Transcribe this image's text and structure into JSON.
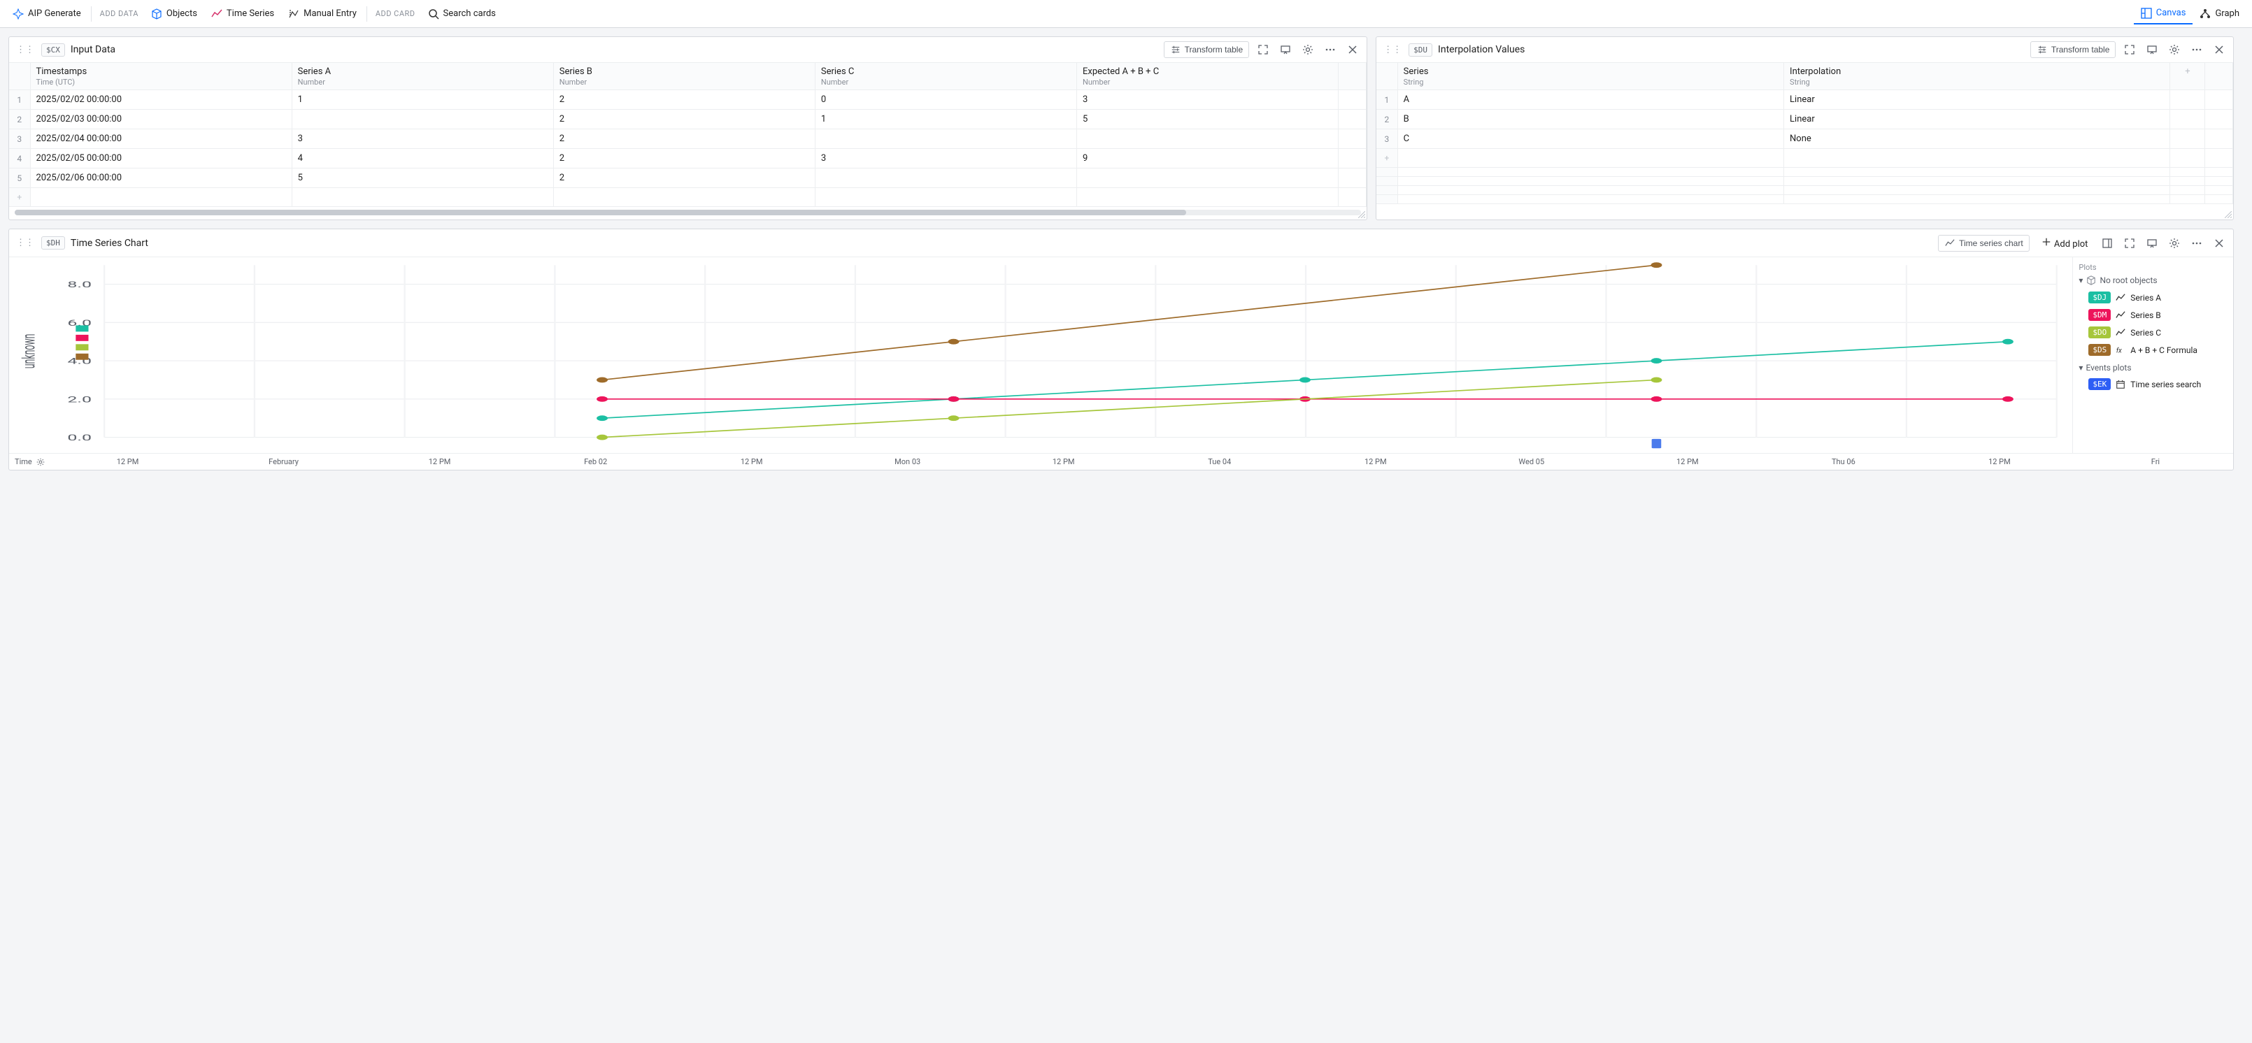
{
  "toolbar": {
    "aip_generate": "AIP Generate",
    "add_data_label": "ADD DATA",
    "objects": "Objects",
    "time_series": "Time Series",
    "manual_entry": "Manual Entry",
    "add_card_label": "ADD CARD",
    "search_placeholder": "Search cards",
    "canvas_tab": "Canvas",
    "graph_tab": "Graph"
  },
  "card_input": {
    "token": "$CX",
    "title": "Input Data",
    "transform_label": "Transform table",
    "columns": [
      {
        "name": "Timestamps",
        "type": "Time (UTC)"
      },
      {
        "name": "Series A",
        "type": "Number"
      },
      {
        "name": "Series B",
        "type": "Number"
      },
      {
        "name": "Series C",
        "type": "Number"
      },
      {
        "name": "Expected A + B + C",
        "type": "Number"
      }
    ],
    "rows": [
      [
        "2025/02/02 00:00:00",
        "1",
        "2",
        "0",
        "3"
      ],
      [
        "2025/02/03 00:00:00",
        "",
        "2",
        "1",
        "5"
      ],
      [
        "2025/02/04 00:00:00",
        "3",
        "2",
        "",
        ""
      ],
      [
        "2025/02/05 00:00:00",
        "4",
        "2",
        "3",
        "9"
      ],
      [
        "2025/02/06 00:00:00",
        "5",
        "2",
        "",
        ""
      ]
    ]
  },
  "card_interp": {
    "token": "$DU",
    "title": "Interpolation Values",
    "transform_label": "Transform table",
    "columns": [
      {
        "name": "Series",
        "type": "String"
      },
      {
        "name": "Interpolation",
        "type": "String"
      }
    ],
    "rows": [
      [
        "A",
        "Linear"
      ],
      [
        "B",
        "Linear"
      ],
      [
        "C",
        "None"
      ]
    ]
  },
  "card_chart": {
    "token": "$DH",
    "title": "Time Series Chart",
    "type_label": "Time series chart",
    "add_plot": "Add plot",
    "legend": {
      "plots_label": "Plots",
      "no_root": "No root objects",
      "items": [
        {
          "token": "$DJ",
          "color": "#1bbfa3",
          "label": "Series A",
          "icon": "line"
        },
        {
          "token": "$DM",
          "color": "#ed145b",
          "label": "Series B",
          "icon": "line"
        },
        {
          "token": "$DO",
          "color": "#a6c63b",
          "label": "Series C",
          "icon": "line"
        },
        {
          "token": "$DS",
          "color": "#9e6b2a",
          "label": "A + B + C Formula",
          "icon": "formula"
        }
      ],
      "events_label": "Events plots",
      "events_item": {
        "token": "$EK",
        "color": "#2d5ef5",
        "label": "Time series search"
      }
    },
    "y_label": "unknown",
    "time_label": "Time",
    "x_ticks": [
      "12 PM",
      "February",
      "12 PM",
      "Feb 02",
      "12 PM",
      "Mon 03",
      "12 PM",
      "Tue 04",
      "12 PM",
      "Wed 05",
      "12 PM",
      "Thu 06",
      "12 PM",
      "Fri"
    ]
  },
  "chart_data": {
    "type": "line",
    "title": "",
    "xlabel": "Time",
    "ylabel": "unknown",
    "ylim": [
      0,
      9
    ],
    "y_ticks": [
      0.0,
      2.0,
      4.0,
      6.0,
      8.0
    ],
    "x_categories": [
      "Feb 02",
      "Mon 03",
      "Tue 04",
      "Wed 05",
      "Thu 06"
    ],
    "series": [
      {
        "name": "Series A",
        "color": "#1bbfa3",
        "values": [
          1,
          2,
          3,
          4,
          5
        ]
      },
      {
        "name": "Series B",
        "color": "#ed145b",
        "values": [
          2,
          2,
          2,
          2,
          2
        ]
      },
      {
        "name": "Series C",
        "color": "#a6c63b",
        "values": [
          0,
          1,
          null,
          3,
          null
        ]
      },
      {
        "name": "A + B + C Formula",
        "color": "#9e6b2a",
        "values": [
          3,
          5,
          null,
          9,
          null
        ]
      }
    ]
  }
}
